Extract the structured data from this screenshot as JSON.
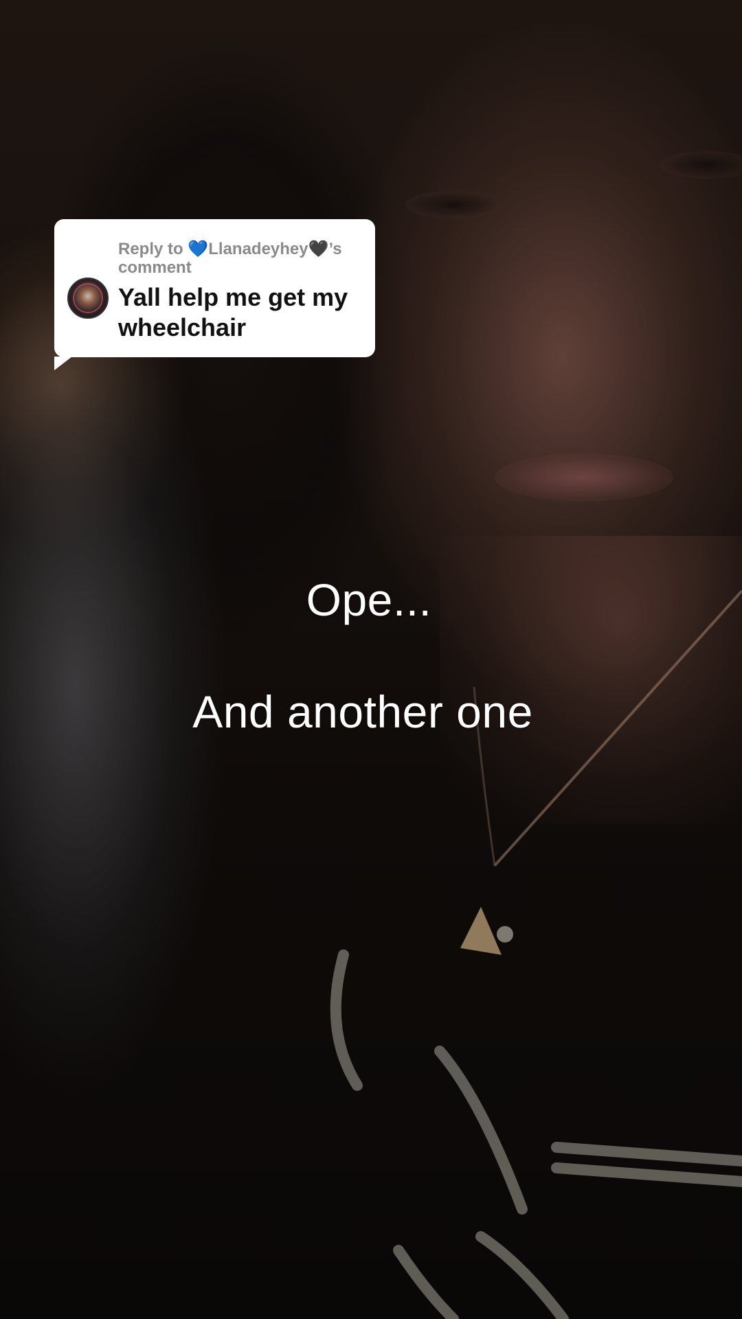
{
  "reply_sticker": {
    "prefix": "Reply to ",
    "heart_blue": "💙",
    "username": "Llanadeyhey",
    "heart_black": "🖤",
    "suffix": "’s comment",
    "comment_text": "Yall help me get my wheelchair",
    "avatar_icon": "profile-avatar-icon"
  },
  "captions": {
    "line1": "Ope...",
    "line2": "And another one"
  },
  "colors": {
    "sticker_bg": "#ffffff",
    "meta_text": "#8a8a8a",
    "comment_text": "#111111",
    "caption_text": "#ffffff"
  }
}
